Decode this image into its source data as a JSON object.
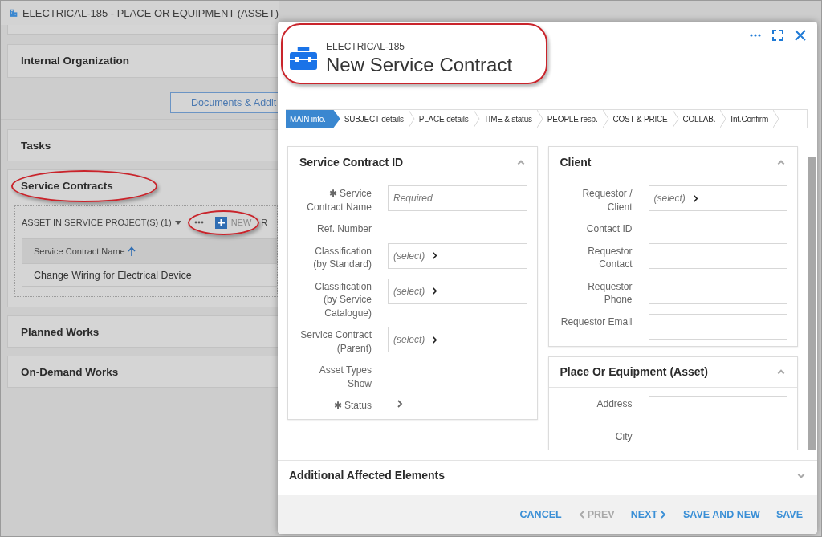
{
  "page": {
    "title": "ELECTRICAL-185 - PLACE OR EQUIPMENT (ASSET)",
    "top_panel": {
      "title": "Internal Organization"
    },
    "documents_button": {
      "label": "Documents & Addit"
    },
    "panels": [
      {
        "title": "Tasks",
        "highlighted": false
      },
      {
        "title": "Service Contracts",
        "highlighted": true,
        "grid": {
          "dropdown": "ASSET IN SERVICE PROJECT(S) (1)",
          "new_button": {
            "label": "NEW",
            "highlighted": true
          },
          "next_item": "R",
          "columns": [
            {
              "label": "Service Contract Name",
              "sorted": true
            }
          ],
          "rows": [
            [
              "Change Wiring for Electrical Device"
            ]
          ]
        }
      },
      {
        "title": "Planned Works",
        "highlighted": false
      },
      {
        "title": "On-Demand Works",
        "highlighted": false
      }
    ]
  },
  "modal": {
    "subtitle": "ELECTRICAL-185",
    "title": "New Service Contract",
    "highlighted": true,
    "steps": [
      {
        "label": "MAIN info.",
        "selected": true
      },
      {
        "label": "SUBJECT details",
        "selected": false
      },
      {
        "label": "PLACE details",
        "selected": false
      },
      {
        "label": "TIME & status",
        "selected": false
      },
      {
        "label": "PEOPLE resp.",
        "selected": false
      },
      {
        "label": "COST & PRICE",
        "selected": false
      },
      {
        "label": "COLLAB.",
        "selected": false
      },
      {
        "label": "Int.Confirm",
        "selected": false
      }
    ],
    "columns": [
      [
        {
          "title": "Service Contract ID",
          "expanded": true,
          "fields": [
            {
              "label": "✱ Service Contract Name",
              "kind": "text",
              "placeholder": "Required"
            },
            {
              "label": "Ref. Number",
              "kind": "readonly"
            },
            {
              "label": "Classification (by Standard)",
              "kind": "select",
              "placeholder": "(select)"
            },
            {
              "label": "Classification (by Service Catalogue)",
              "kind": "select",
              "placeholder": "(select)"
            },
            {
              "label": "Service Contract (Parent)",
              "kind": "select",
              "placeholder": "(select)"
            },
            {
              "label": "Asset Types Show",
              "kind": "readonly"
            },
            {
              "label": "✱ Status",
              "kind": "link"
            }
          ]
        }
      ],
      [
        {
          "title": "Client",
          "expanded": true,
          "fields": [
            {
              "label": "Requestor / Client",
              "kind": "select",
              "placeholder": "(select)"
            },
            {
              "label": "Contact ID",
              "kind": "readonly"
            },
            {
              "label": "Requestor Contact",
              "kind": "input"
            },
            {
              "label": "Requestor Phone",
              "kind": "input"
            },
            {
              "label": "Requestor Email",
              "kind": "input"
            }
          ]
        },
        {
          "title": "Place Or Equipment (Asset)",
          "expanded": true,
          "fields": [
            {
              "label": "Address",
              "kind": "input"
            },
            {
              "label": "City",
              "kind": "input"
            }
          ]
        }
      ]
    ],
    "bottom_section": {
      "title": "Additional Affected Elements",
      "expanded": false
    },
    "footer": [
      {
        "label": "CANCEL",
        "kind": "plain",
        "disabled": false
      },
      {
        "label": "PREV",
        "kind": "prev",
        "disabled": true
      },
      {
        "label": "NEXT",
        "kind": "next",
        "disabled": false
      },
      {
        "label": "SAVE AND NEW",
        "kind": "plain",
        "disabled": false
      },
      {
        "label": "SAVE",
        "kind": "plain",
        "disabled": false
      }
    ]
  }
}
